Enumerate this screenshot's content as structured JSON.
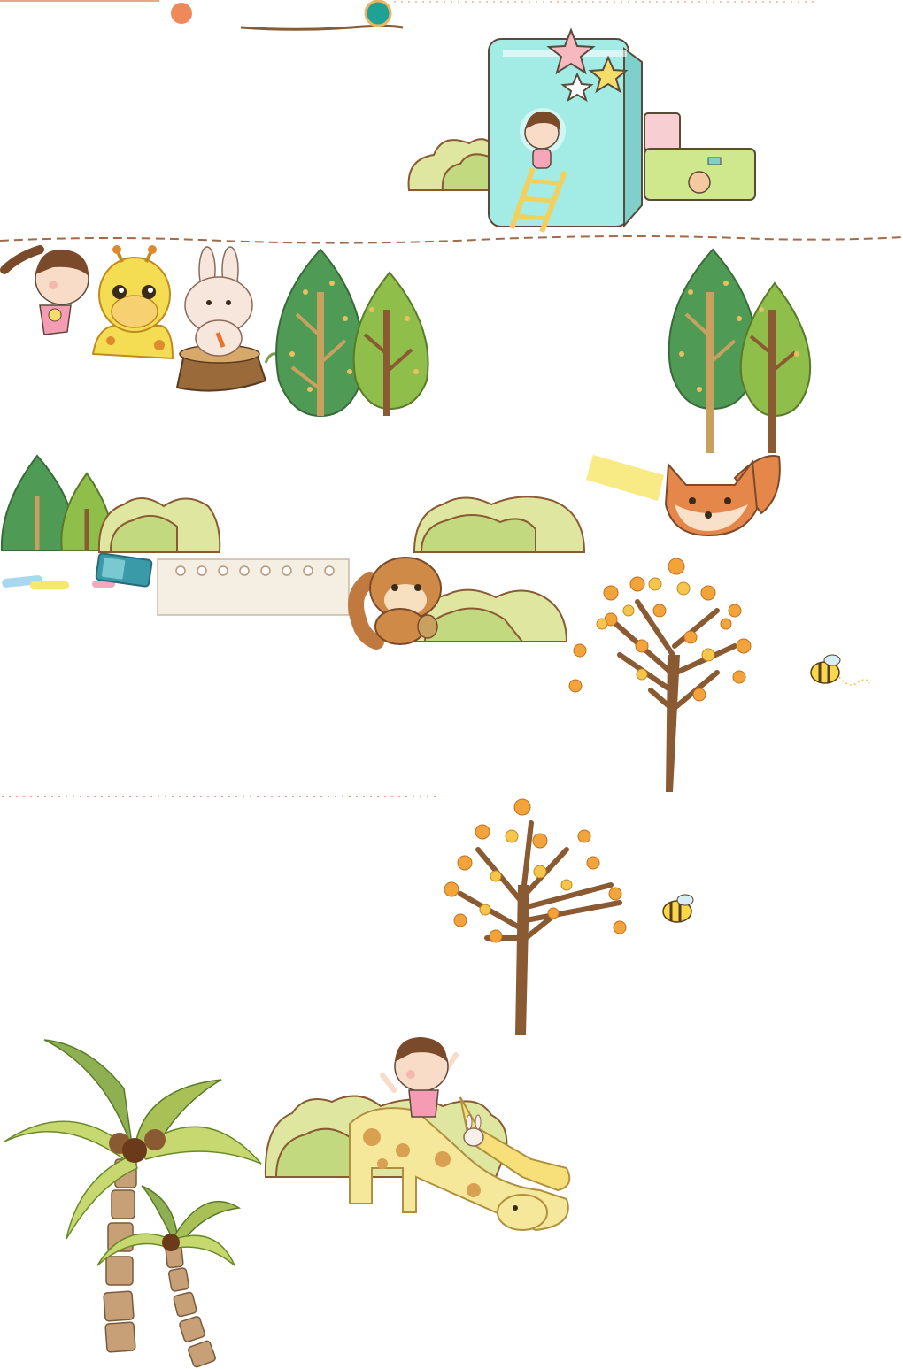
{
  "scene": {
    "description_free": true,
    "palette": {
      "leaf_dark": "#4f9a55",
      "leaf_light": "#8fbf4a",
      "bush_light": "#dfe6a0",
      "bush_mid": "#c2d97f",
      "trunk": "#8a5a33",
      "autumn_leaf": "#f2a33a",
      "autumn_leaf_light": "#f6c54b",
      "book_cyan": "#a3ece6",
      "book_green": "#cfe88e",
      "book_pink": "#f7cfd2",
      "fox": "#e5874a",
      "giraffe": "#f4dc53",
      "tape": "#f8ea85",
      "paper": "#f5efe3",
      "orange_dot": "#f0895a",
      "teal_dot": "#1fa296",
      "dash_line": "#a06b4a",
      "dot_line": "#f0a28a"
    },
    "icons": [
      "girl-icon",
      "giraffe-icon",
      "rabbit-icon",
      "tree-icon",
      "bush-icon",
      "fox-icon",
      "squirrel-icon",
      "autumn-tree-icon",
      "bee-icon",
      "palm-tree-icon",
      "giraffe-slide-icon",
      "book-icon",
      "star-icon",
      "chalk-icon",
      "eraser-icon",
      "note-paper-icon",
      "tape-icon"
    ]
  }
}
